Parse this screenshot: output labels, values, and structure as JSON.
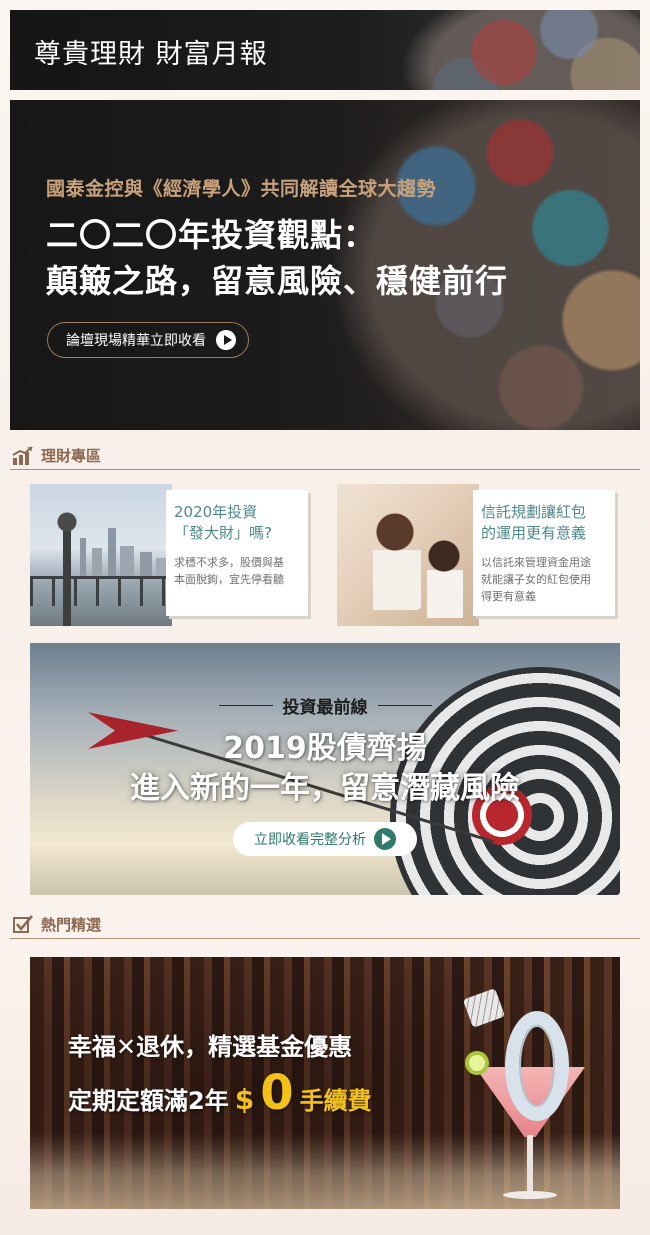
{
  "header": {
    "title": "尊貴理財 財富月報"
  },
  "hero": {
    "subtitle": "國泰金控與《經濟學人》共同解讀全球大趨勢",
    "title_line1": "二〇二〇年投資觀點：",
    "title_line2": "顛簸之路，留意風險、穩健前行",
    "cta_label": "論壇現場精華立即收看"
  },
  "finance_zone": {
    "label": "理財專區",
    "cards": [
      {
        "title_line1": "2020年投資",
        "title_line2": "「發大財」嗎?",
        "desc_line1": "求穩不求多，股價與基",
        "desc_line2": "本面脫鉤，宜先停看聽"
      },
      {
        "title_line1": "信託規劃讓紅包",
        "title_line2": "的運用更有意義",
        "desc_line1": "以信託來管理資金用途",
        "desc_line2": "就能讓子女的紅包使用",
        "desc_line3": "得更有意義"
      }
    ]
  },
  "invest_banner": {
    "kicker": "投資最前線",
    "title_line1": "2019股債齊揚",
    "title_line2": "進入新的一年，留意潛藏風險",
    "cta_label": "立即收看完整分析"
  },
  "hot_picks": {
    "label": "熱門精選"
  },
  "promo_banner": {
    "line1": "幸福✕退休，精選基金優惠",
    "line2_prefix": "定期定額滿2年",
    "line2_dollar": "$",
    "line2_zero": "0",
    "line2_suffix": "手續費"
  },
  "colors": {
    "accent_brown": "#8c6a52",
    "card_title_teal": "#4e8a8b",
    "hero_subtitle_gold": "#c8a27c",
    "cta_green": "#2f7a6b",
    "promo_yellow": "#f2c21a"
  }
}
